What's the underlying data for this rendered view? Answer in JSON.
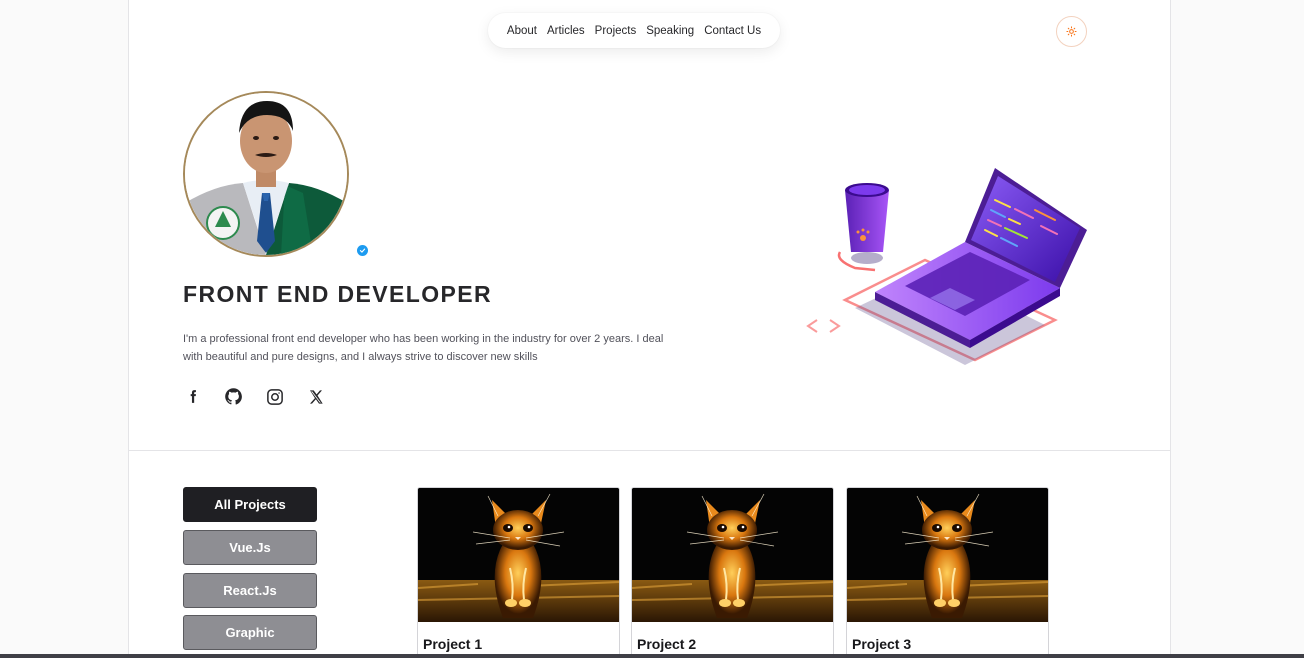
{
  "nav": {
    "items": [
      "About",
      "Articles",
      "Projects",
      "Speaking",
      "Contact Us"
    ]
  },
  "theme_toggle": {
    "icon": "sun-icon",
    "accent": "#f97316"
  },
  "hero": {
    "title": "FRONT END DEVELOPER",
    "bio": "I'm a professional front end developer who has been working in the industry for over 2 years. I deal with beautiful and pure designs, and I always strive to discover new skills",
    "avatar_icon": "profile-photo",
    "verified_icon": "verified-badge-icon",
    "socials": [
      "facebook-icon",
      "github-icon",
      "instagram-icon",
      "x-icon"
    ]
  },
  "filters": [
    {
      "label": "All Projects",
      "active": true
    },
    {
      "label": "Vue.Js",
      "active": false
    },
    {
      "label": "React.Js",
      "active": false
    },
    {
      "label": "Graphic",
      "active": false
    }
  ],
  "projects": [
    {
      "title": "Project 1"
    },
    {
      "title": "Project 2"
    },
    {
      "title": "Project 3"
    }
  ],
  "colors": {
    "active_filter": "#1f1f23",
    "inactive_filter": "#8e8e93",
    "avatar_ring": "#a5895a",
    "laptop": "#6d28d9"
  }
}
